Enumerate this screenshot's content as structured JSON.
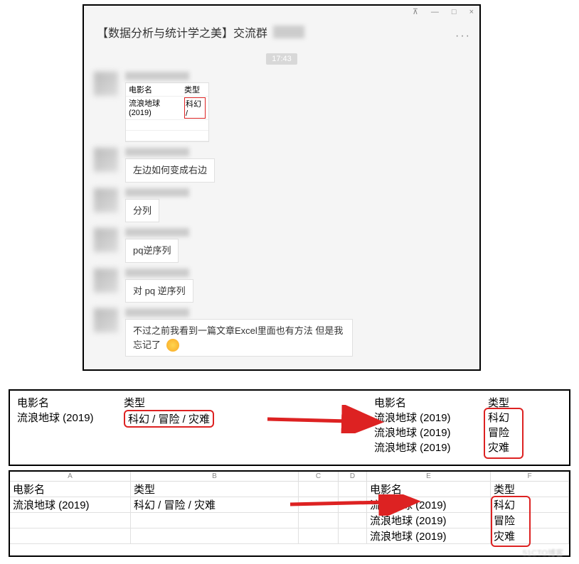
{
  "window": {
    "controls": {
      "pin": "⊼",
      "min": "—",
      "max": "□",
      "close": "×"
    },
    "title": "【数据分析与统计学之美】交流群",
    "more": "···",
    "time": "17:43"
  },
  "messages": {
    "m1": {
      "table": {
        "h1": "电影名",
        "h2": "类型",
        "r1c1": "流浪地球 (2019)",
        "r1c2": "科幻 /"
      }
    },
    "m2": {
      "text": "左边如何变成右边"
    },
    "m3": {
      "text": "分列"
    },
    "m4": {
      "text": "pq逆序列"
    },
    "m5": {
      "text": "对 pq 逆序列"
    },
    "m6": {
      "text": "不过之前我看到一篇文章Excel里面也有方法 但是我忘记了"
    }
  },
  "panel1": {
    "left": {
      "h1": "电影名",
      "h2": "类型",
      "r1c1": "流浪地球 (2019)",
      "r1c2": "科幻 / 冒险 / 灾难"
    },
    "right": {
      "h1": "电影名",
      "h2": "类型",
      "r1": "流浪地球 (2019)",
      "t1": "科幻",
      "r2": "流浪地球 (2019)",
      "t2": "冒险",
      "r3": "流浪地球 (2019)",
      "t3": "灾难"
    }
  },
  "panel2": {
    "cols": {
      "a": "A",
      "b": "B",
      "c": "C",
      "d": "D",
      "e": "E",
      "f": "F"
    },
    "left": {
      "h1": "电影名",
      "h2": "类型",
      "r1c1": "流浪地球 (2019)",
      "r1c2": "科幻 / 冒险 / 灾难"
    },
    "right": {
      "h1": "电影名",
      "h2": "类型",
      "r1": "流浪地球 (2019)",
      "t1": "科幻",
      "r2": "流浪地球 (2019)",
      "t2": "冒险",
      "r3": "流浪地球 (2019)",
      "t3": "灾难"
    }
  }
}
